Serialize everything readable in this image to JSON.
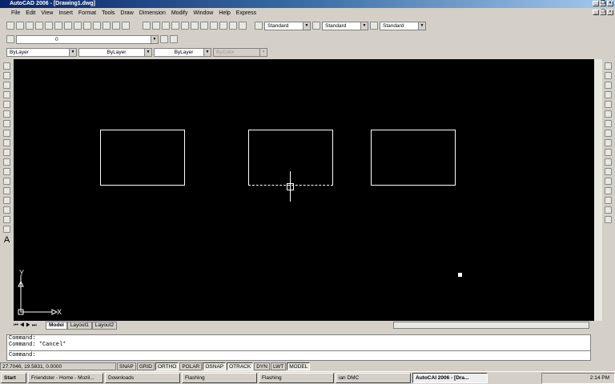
{
  "window": {
    "title": "AutoCAD 2006 - [Drawing1.dwg]"
  },
  "menu": [
    "File",
    "Edit",
    "View",
    "Insert",
    "Format",
    "Tools",
    "Draw",
    "Dimension",
    "Modify",
    "Window",
    "Help",
    "Express"
  ],
  "styles": {
    "text_style": "Standard",
    "dim_style": "Standard",
    "table_style": "Standard"
  },
  "layer": {
    "current": "0"
  },
  "properties": {
    "color": "ByLayer",
    "linetype": "ByLayer",
    "lineweight": "ByLayer",
    "plotstyle": "ByColor"
  },
  "ucs": {
    "x_label": "X",
    "y_label": "Y"
  },
  "tabs": [
    "Model",
    "Layout1",
    "Layout2"
  ],
  "command": {
    "lines": [
      "Command:",
      "Command: *Cancel*"
    ],
    "prompt": "Command:"
  },
  "status": {
    "coords": "27.7046, 19.5831, 0.0000",
    "toggles": [
      "SNAP",
      "GRID",
      "ORTHO",
      "POLAR",
      "OSNAP",
      "OTRACK",
      "DYN",
      "LWT",
      "MODEL"
    ]
  },
  "taskbar": {
    "start": "Start",
    "tasks": [
      "Friendster - Home - Mozil...",
      "Downloads",
      "Flashing",
      "Flashing",
      "ian DMC",
      "AutoCAI 2006 - [Dra..."
    ],
    "clock": "2:14 PM"
  }
}
